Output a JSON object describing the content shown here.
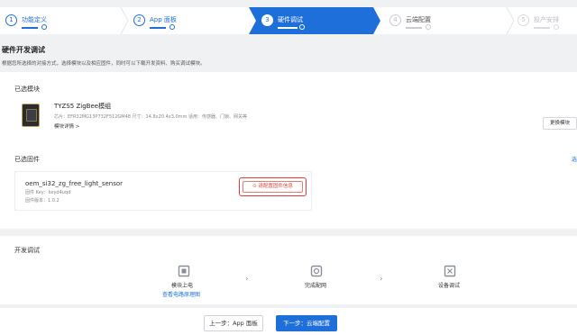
{
  "stepper": {
    "steps": [
      {
        "num": "1",
        "label": "功能定义"
      },
      {
        "num": "2",
        "label": "App 面板"
      },
      {
        "num": "3",
        "label": "硬件调试"
      },
      {
        "num": "4",
        "label": "云端配置"
      },
      {
        "num": "5",
        "label": "投产安排"
      }
    ]
  },
  "page": {
    "title": "硬件开发调试",
    "description": "根据您所选择的对接方式，选择模块以及相应固件，同时可以下载开发资料、购买调试模块。"
  },
  "module_section": {
    "title": "已选模块",
    "module_name": "TYZS5 ZigBee模组",
    "module_spec": "芯片：EFR32MG13P732F512GM48   尺寸：14.8x20.4x3.0mm   适用：传感器、门锁、网关等",
    "detail_link": "模块详情 >",
    "change_button": "更换模块"
  },
  "firmware_section": {
    "title": "已选固件",
    "edge_link": "选",
    "firmware_name": "oem_si32_zg_free_light_sensor",
    "firmware_key": "固件 Key：keyd4uqd",
    "firmware_version": "固件版本：1.0.2",
    "config_button": "请配置固件信息"
  },
  "dev_section": {
    "title": "开发调试",
    "steps": [
      {
        "label": "模块上电",
        "link": "查看电路原理图"
      },
      {
        "label": "完成配网"
      },
      {
        "label": "设备调试"
      }
    ]
  },
  "footer": {
    "prev_button": "上一步：App 面板",
    "next_button": "下一步：云端配置"
  },
  "colors": {
    "accent": "#1e6fd9",
    "alert": "#e53935"
  }
}
